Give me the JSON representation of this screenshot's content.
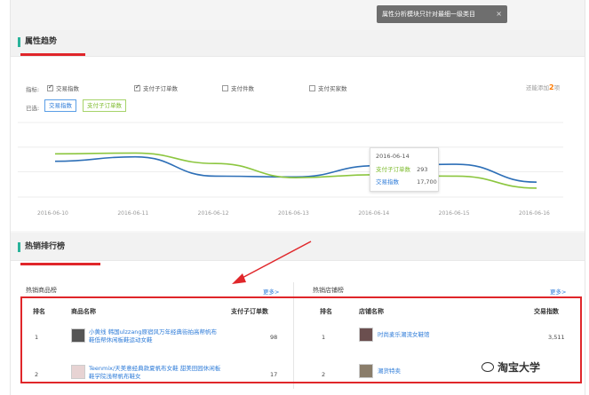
{
  "toast": {
    "text": "属性分析模块只针对最细一级类目",
    "close": "×"
  },
  "trend_section": {
    "title": "属性趋势",
    "indicator_label": "指标:",
    "checkboxes": [
      {
        "label": "交易指数",
        "checked": true
      },
      {
        "label": "支付子订单数",
        "checked": true
      },
      {
        "label": "支付件数",
        "checked": false
      },
      {
        "label": "支付买家数",
        "checked": false
      }
    ],
    "count_prefix": "还能添加",
    "count_value": "2",
    "count_suffix": "项",
    "selected_label": "已选:",
    "selected_tags": [
      "交易指数",
      "支付子订单数"
    ]
  },
  "chart_data": {
    "type": "line",
    "x": [
      "2016-06-10",
      "2016-06-11",
      "2016-06-12",
      "2016-06-13",
      "2016-06-14",
      "2016-06-15",
      "2016-06-16"
    ],
    "series": [
      {
        "name": "交易指数",
        "color": "#2d6fb7",
        "values": [
          0.52,
          0.46,
          0.72,
          0.73,
          0.58,
          0.56,
          0.8
        ]
      },
      {
        "name": "支付子订单数",
        "color": "#8cc63f",
        "values": [
          0.42,
          0.41,
          0.55,
          0.74,
          0.7,
          0.72,
          0.88
        ]
      }
    ],
    "tooltip": {
      "date": "2016-06-14",
      "rows": [
        {
          "name": "支付子订单数",
          "value": "293"
        },
        {
          "name": "交易指数",
          "value": "17,700"
        }
      ]
    }
  },
  "hot_section": {
    "title": "热销排行榜",
    "products": {
      "label": "热销商品榜",
      "more": "更多>",
      "headers": [
        "排名",
        "商品名称",
        "支付子订单数"
      ],
      "rows": [
        {
          "rank": "1",
          "name": "小黄线 韩国ulzzang原宿风万年经典街拍高帮帆布鞋低帮休闲板鞋运动女鞋",
          "value": "98"
        },
        {
          "rank": "2",
          "name": "Teenmix/天美意经典款夏帆布女鞋 甜美田园休闲板鞋学院浅帮帆布鞋女",
          "value": "17"
        }
      ]
    },
    "shops": {
      "label": "热销店铺榜",
      "more": "更多>",
      "headers": [
        "排名",
        "店铺名称",
        "交易指数"
      ],
      "rows": [
        {
          "rank": "1",
          "name": "时尚麦乐潮流女鞋馆",
          "value": "3,511"
        },
        {
          "rank": "2",
          "name": "潮货特卖",
          "value": ""
        }
      ]
    }
  },
  "watermark": {
    "text": "淘宝大学"
  }
}
